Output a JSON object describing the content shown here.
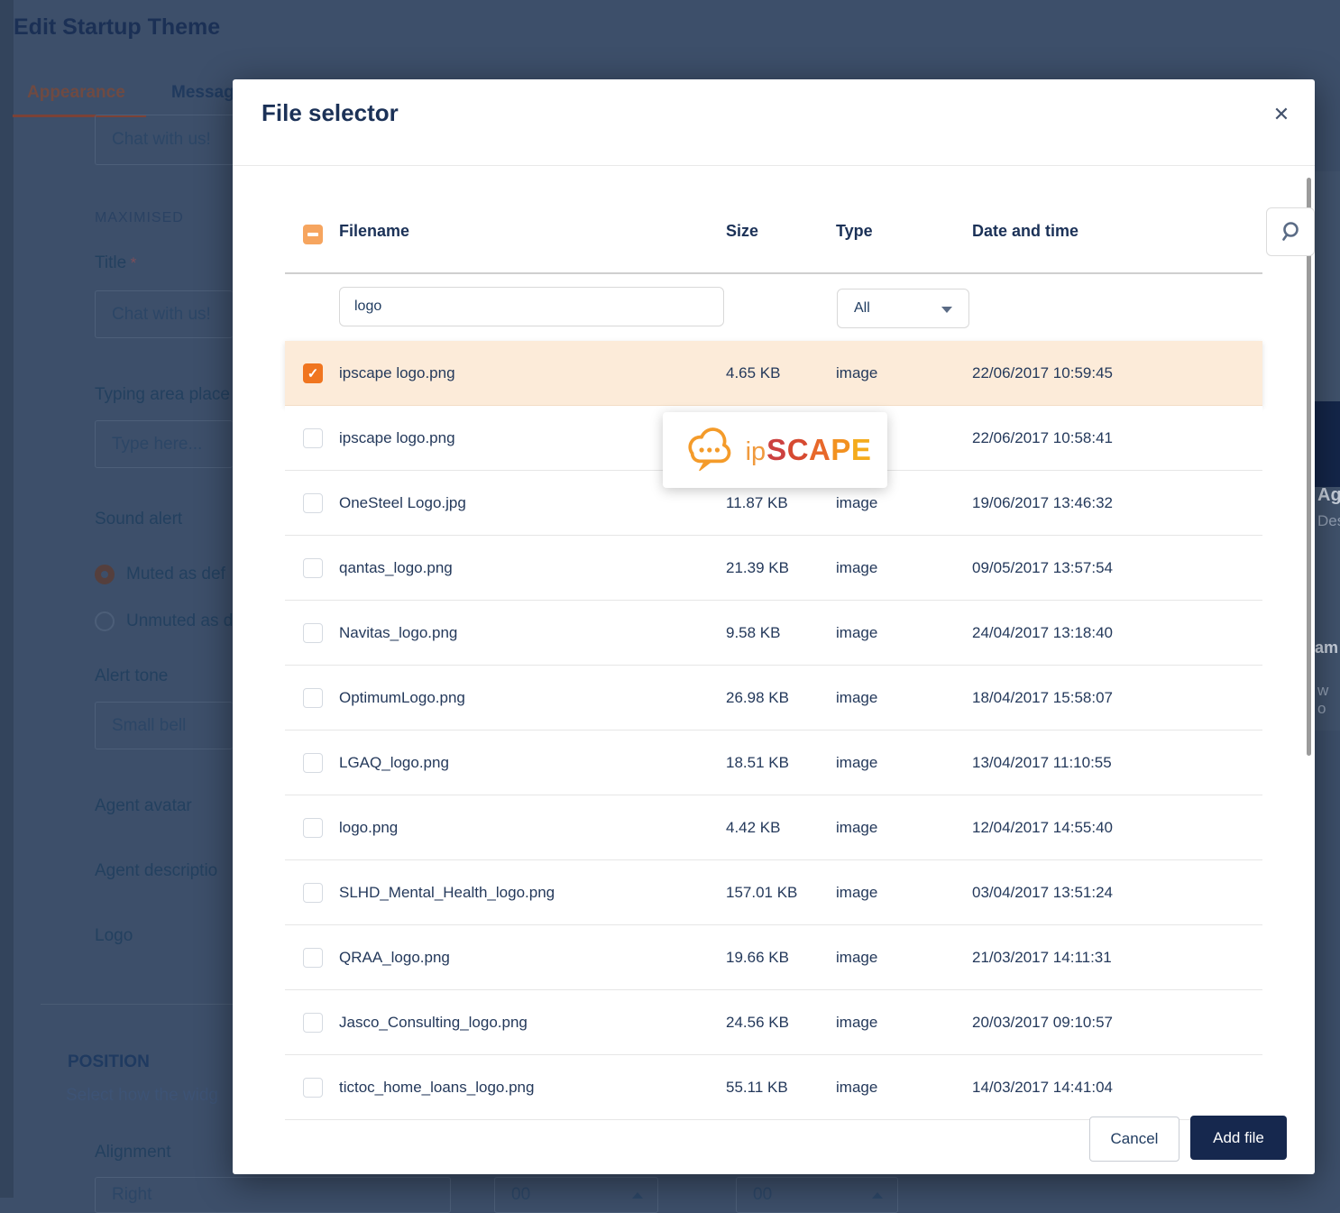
{
  "background": {
    "page_title": "Edit Startup Theme",
    "tabs": [
      {
        "label": "Appearance",
        "active": true
      },
      {
        "label": "Messag",
        "active": false
      }
    ],
    "preview_title": "Chat with us!",
    "section_label": "MAXIMISED",
    "fields": {
      "title_label": "Title",
      "title_required_mark": "*",
      "title_value": "Chat with us!",
      "typing_label": "Typing area place",
      "typing_value": "Type here...",
      "sound_label": "Sound alert",
      "radio_muted_label": "Muted as def",
      "radio_unmuted_label": "Unmuted as d",
      "alert_tone_label": "Alert tone",
      "alert_tone_value": "Small bell",
      "agent_avatar_label": "Agent avatar",
      "agent_description_label": "Agent descriptio",
      "logo_label": "Logo"
    },
    "position_section": {
      "title": "POSITION",
      "subtitle": "Select how the widg",
      "alignment_label": "Alignment",
      "alignment_value": "Right",
      "spin_value_1": "00",
      "spin_value_2": "00"
    },
    "right_fragments": {
      "f1": "Ag",
      "f2": "Des",
      "f3": "am",
      "f4": "w o"
    }
  },
  "modal": {
    "title": "File selector",
    "close_glyph": "✕",
    "columns": {
      "filename": "Filename",
      "size": "Size",
      "type": "Type",
      "date": "Date and time"
    },
    "filter": {
      "filename_value": "logo",
      "type_value": "All"
    },
    "rows": [
      {
        "name": "ipscape logo.png",
        "size": "4.65 KB",
        "type": "image",
        "date": "22/06/2017 10:59:45",
        "checked": true,
        "selected": true
      },
      {
        "name": "ipscape logo.png",
        "size": "",
        "type": "",
        "date": "22/06/2017 10:58:41",
        "checked": false,
        "selected": false
      },
      {
        "name": "OneSteel Logo.jpg",
        "size": "11.87 KB",
        "type": "image",
        "date": "19/06/2017 13:46:32",
        "checked": false,
        "selected": false
      },
      {
        "name": "qantas_logo.png",
        "size": "21.39 KB",
        "type": "image",
        "date": "09/05/2017 13:57:54",
        "checked": false,
        "selected": false
      },
      {
        "name": "Navitas_logo.png",
        "size": "9.58 KB",
        "type": "image",
        "date": "24/04/2017 13:18:40",
        "checked": false,
        "selected": false
      },
      {
        "name": "OptimumLogo.png",
        "size": "26.98 KB",
        "type": "image",
        "date": "18/04/2017 15:58:07",
        "checked": false,
        "selected": false
      },
      {
        "name": "LGAQ_logo.png",
        "size": "18.51 KB",
        "type": "image",
        "date": "13/04/2017 11:10:55",
        "checked": false,
        "selected": false
      },
      {
        "name": "logo.png",
        "size": "4.42 KB",
        "type": "image",
        "date": "12/04/2017 14:55:40",
        "checked": false,
        "selected": false
      },
      {
        "name": "SLHD_Mental_Health_logo.png",
        "size": "157.01 KB",
        "type": "image",
        "date": "03/04/2017 13:51:24",
        "checked": false,
        "selected": false
      },
      {
        "name": "QRAA_logo.png",
        "size": "19.66 KB",
        "type": "image",
        "date": "21/03/2017 14:11:31",
        "checked": false,
        "selected": false
      },
      {
        "name": "Jasco_Consulting_logo.png",
        "size": "24.56 KB",
        "type": "image",
        "date": "20/03/2017 09:10:57",
        "checked": false,
        "selected": false
      },
      {
        "name": "tictoc_home_loans_logo.png",
        "size": "55.11 KB",
        "type": "image",
        "date": "14/03/2017 14:41:04",
        "checked": false,
        "selected": false
      }
    ],
    "tooltip_brand": [
      {
        "t": "ip",
        "c": "#f09a3e",
        "caps": false
      },
      {
        "t": "S",
        "c": "#cc4140",
        "caps": true
      },
      {
        "t": "C",
        "c": "#d64a31",
        "caps": true
      },
      {
        "t": "A",
        "c": "#e8682a",
        "caps": true
      },
      {
        "t": "P",
        "c": "#f29120",
        "caps": true
      },
      {
        "t": "E",
        "c": "#f4ab1c",
        "caps": true
      }
    ],
    "footer": {
      "cancel_label": "Cancel",
      "add_label": "Add file"
    }
  },
  "colors": {
    "accent_orange": "#f0751f",
    "indeterminate_orange": "#f6a55f",
    "selected_row_bg": "#fcebd9",
    "primary_navy": "#16284e",
    "text_navy": "#1e3a5f",
    "overlay_bg": "#3d4f6a",
    "logo_cloud": "#f49b2a"
  }
}
